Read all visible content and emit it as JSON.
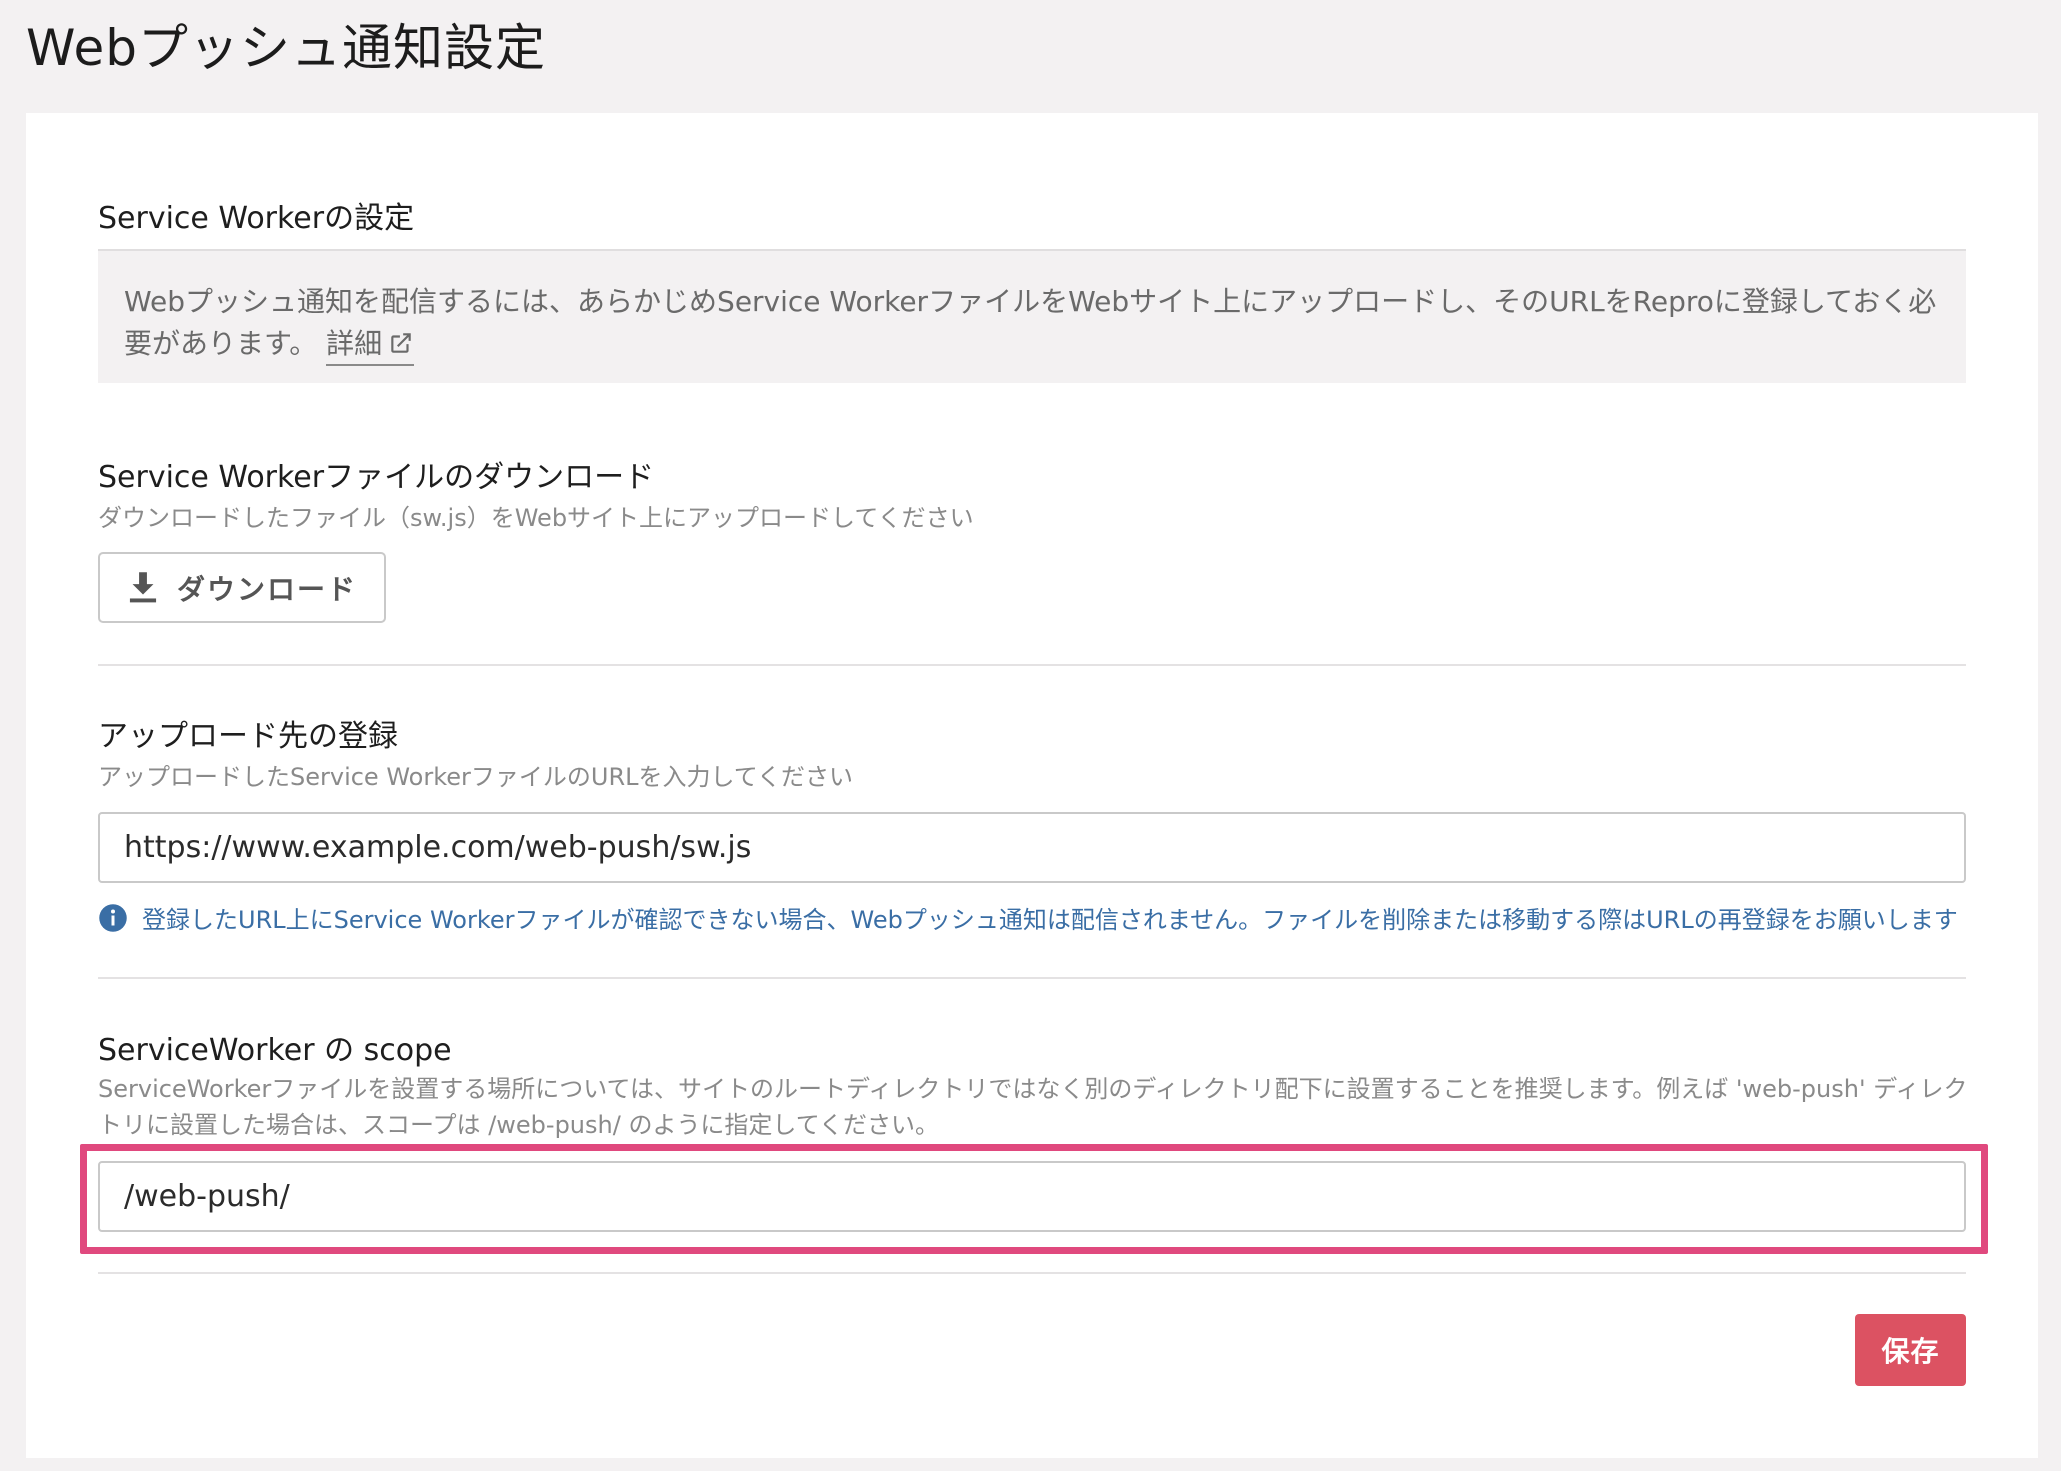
{
  "page": {
    "title": "Webプッシュ通知設定"
  },
  "service_worker": {
    "heading": "Service Workerの設定",
    "info_text": "Webプッシュ通知を配信するには、あらかじめService WorkerファイルをWebサイト上にアップロードし、そのURLをReproに登録しておく必要があります。",
    "detail_link": "詳細",
    "detail_icon": "external-link-icon"
  },
  "download": {
    "heading": "Service Workerファイルのダウンロード",
    "description": "ダウンロードしたファイル（sw.js）をWebサイト上にアップロードしてください",
    "button_label": "ダウンロード",
    "button_icon": "download-icon"
  },
  "upload": {
    "heading": "アップロード先の登録",
    "description": "アップロードしたService WorkerファイルのURLを入力してください",
    "url_value": "https://www.example.com/web-push/sw.js",
    "notice": "登録したURL上にService Workerファイルが確認できない場合、Webプッシュ通知は配信されません。ファイルを削除または移動する際はURLの再登録をお願いします",
    "notice_icon": "info-icon",
    "notice_color": "#3a6ea5"
  },
  "scope": {
    "heading": "ServiceWorker の scope",
    "description": "ServiceWorkerファイルを設置する場所については、サイトのルートディレクトリではなく別のディレクトリ配下に設置することを推奨します。例えば 'web-push' ディレクトリに設置した場合は、スコープは /web-push/ のように指定してください。",
    "value": "/web-push/",
    "highlight_color": "#e0497e"
  },
  "actions": {
    "save_label": "保存",
    "save_color": "#dc5262"
  }
}
